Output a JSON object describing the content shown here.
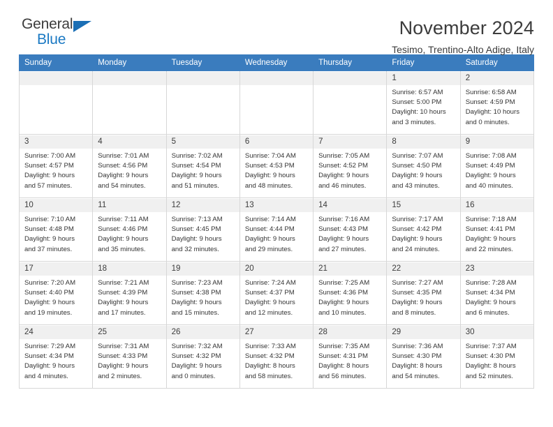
{
  "brand": {
    "name_line1": "General",
    "name_line2": "Blue",
    "logo_icon": "triangle-logo-icon",
    "accent_color": "#1b79c3"
  },
  "header": {
    "title": "November 2024",
    "subtitle": "Tesimo, Trentino-Alto Adige, Italy",
    "header_bg_color": "#3a7cbe"
  },
  "calendar": {
    "weekday_headers": [
      "Sunday",
      "Monday",
      "Tuesday",
      "Wednesday",
      "Thursday",
      "Friday",
      "Saturday"
    ],
    "weeks": [
      [
        {
          "day": "",
          "empty": true
        },
        {
          "day": "",
          "empty": true
        },
        {
          "day": "",
          "empty": true
        },
        {
          "day": "",
          "empty": true
        },
        {
          "day": "",
          "empty": true
        },
        {
          "day": "1",
          "sunrise": "Sunrise: 6:57 AM",
          "sunset": "Sunset: 5:00 PM",
          "daylight_1": "Daylight: 10 hours",
          "daylight_2": "and 3 minutes."
        },
        {
          "day": "2",
          "sunrise": "Sunrise: 6:58 AM",
          "sunset": "Sunset: 4:59 PM",
          "daylight_1": "Daylight: 10 hours",
          "daylight_2": "and 0 minutes."
        }
      ],
      [
        {
          "day": "3",
          "sunrise": "Sunrise: 7:00 AM",
          "sunset": "Sunset: 4:57 PM",
          "daylight_1": "Daylight: 9 hours",
          "daylight_2": "and 57 minutes."
        },
        {
          "day": "4",
          "sunrise": "Sunrise: 7:01 AM",
          "sunset": "Sunset: 4:56 PM",
          "daylight_1": "Daylight: 9 hours",
          "daylight_2": "and 54 minutes."
        },
        {
          "day": "5",
          "sunrise": "Sunrise: 7:02 AM",
          "sunset": "Sunset: 4:54 PM",
          "daylight_1": "Daylight: 9 hours",
          "daylight_2": "and 51 minutes."
        },
        {
          "day": "6",
          "sunrise": "Sunrise: 7:04 AM",
          "sunset": "Sunset: 4:53 PM",
          "daylight_1": "Daylight: 9 hours",
          "daylight_2": "and 48 minutes."
        },
        {
          "day": "7",
          "sunrise": "Sunrise: 7:05 AM",
          "sunset": "Sunset: 4:52 PM",
          "daylight_1": "Daylight: 9 hours",
          "daylight_2": "and 46 minutes."
        },
        {
          "day": "8",
          "sunrise": "Sunrise: 7:07 AM",
          "sunset": "Sunset: 4:50 PM",
          "daylight_1": "Daylight: 9 hours",
          "daylight_2": "and 43 minutes."
        },
        {
          "day": "9",
          "sunrise": "Sunrise: 7:08 AM",
          "sunset": "Sunset: 4:49 PM",
          "daylight_1": "Daylight: 9 hours",
          "daylight_2": "and 40 minutes."
        }
      ],
      [
        {
          "day": "10",
          "sunrise": "Sunrise: 7:10 AM",
          "sunset": "Sunset: 4:48 PM",
          "daylight_1": "Daylight: 9 hours",
          "daylight_2": "and 37 minutes."
        },
        {
          "day": "11",
          "sunrise": "Sunrise: 7:11 AM",
          "sunset": "Sunset: 4:46 PM",
          "daylight_1": "Daylight: 9 hours",
          "daylight_2": "and 35 minutes."
        },
        {
          "day": "12",
          "sunrise": "Sunrise: 7:13 AM",
          "sunset": "Sunset: 4:45 PM",
          "daylight_1": "Daylight: 9 hours",
          "daylight_2": "and 32 minutes."
        },
        {
          "day": "13",
          "sunrise": "Sunrise: 7:14 AM",
          "sunset": "Sunset: 4:44 PM",
          "daylight_1": "Daylight: 9 hours",
          "daylight_2": "and 29 minutes."
        },
        {
          "day": "14",
          "sunrise": "Sunrise: 7:16 AM",
          "sunset": "Sunset: 4:43 PM",
          "daylight_1": "Daylight: 9 hours",
          "daylight_2": "and 27 minutes."
        },
        {
          "day": "15",
          "sunrise": "Sunrise: 7:17 AM",
          "sunset": "Sunset: 4:42 PM",
          "daylight_1": "Daylight: 9 hours",
          "daylight_2": "and 24 minutes."
        },
        {
          "day": "16",
          "sunrise": "Sunrise: 7:18 AM",
          "sunset": "Sunset: 4:41 PM",
          "daylight_1": "Daylight: 9 hours",
          "daylight_2": "and 22 minutes."
        }
      ],
      [
        {
          "day": "17",
          "sunrise": "Sunrise: 7:20 AM",
          "sunset": "Sunset: 4:40 PM",
          "daylight_1": "Daylight: 9 hours",
          "daylight_2": "and 19 minutes."
        },
        {
          "day": "18",
          "sunrise": "Sunrise: 7:21 AM",
          "sunset": "Sunset: 4:39 PM",
          "daylight_1": "Daylight: 9 hours",
          "daylight_2": "and 17 minutes."
        },
        {
          "day": "19",
          "sunrise": "Sunrise: 7:23 AM",
          "sunset": "Sunset: 4:38 PM",
          "daylight_1": "Daylight: 9 hours",
          "daylight_2": "and 15 minutes."
        },
        {
          "day": "20",
          "sunrise": "Sunrise: 7:24 AM",
          "sunset": "Sunset: 4:37 PM",
          "daylight_1": "Daylight: 9 hours",
          "daylight_2": "and 12 minutes."
        },
        {
          "day": "21",
          "sunrise": "Sunrise: 7:25 AM",
          "sunset": "Sunset: 4:36 PM",
          "daylight_1": "Daylight: 9 hours",
          "daylight_2": "and 10 minutes."
        },
        {
          "day": "22",
          "sunrise": "Sunrise: 7:27 AM",
          "sunset": "Sunset: 4:35 PM",
          "daylight_1": "Daylight: 9 hours",
          "daylight_2": "and 8 minutes."
        },
        {
          "day": "23",
          "sunrise": "Sunrise: 7:28 AM",
          "sunset": "Sunset: 4:34 PM",
          "daylight_1": "Daylight: 9 hours",
          "daylight_2": "and 6 minutes."
        }
      ],
      [
        {
          "day": "24",
          "sunrise": "Sunrise: 7:29 AM",
          "sunset": "Sunset: 4:34 PM",
          "daylight_1": "Daylight: 9 hours",
          "daylight_2": "and 4 minutes."
        },
        {
          "day": "25",
          "sunrise": "Sunrise: 7:31 AM",
          "sunset": "Sunset: 4:33 PM",
          "daylight_1": "Daylight: 9 hours",
          "daylight_2": "and 2 minutes."
        },
        {
          "day": "26",
          "sunrise": "Sunrise: 7:32 AM",
          "sunset": "Sunset: 4:32 PM",
          "daylight_1": "Daylight: 9 hours",
          "daylight_2": "and 0 minutes."
        },
        {
          "day": "27",
          "sunrise": "Sunrise: 7:33 AM",
          "sunset": "Sunset: 4:32 PM",
          "daylight_1": "Daylight: 8 hours",
          "daylight_2": "and 58 minutes."
        },
        {
          "day": "28",
          "sunrise": "Sunrise: 7:35 AM",
          "sunset": "Sunset: 4:31 PM",
          "daylight_1": "Daylight: 8 hours",
          "daylight_2": "and 56 minutes."
        },
        {
          "day": "29",
          "sunrise": "Sunrise: 7:36 AM",
          "sunset": "Sunset: 4:30 PM",
          "daylight_1": "Daylight: 8 hours",
          "daylight_2": "and 54 minutes."
        },
        {
          "day": "30",
          "sunrise": "Sunrise: 7:37 AM",
          "sunset": "Sunset: 4:30 PM",
          "daylight_1": "Daylight: 8 hours",
          "daylight_2": "and 52 minutes."
        }
      ]
    ]
  }
}
